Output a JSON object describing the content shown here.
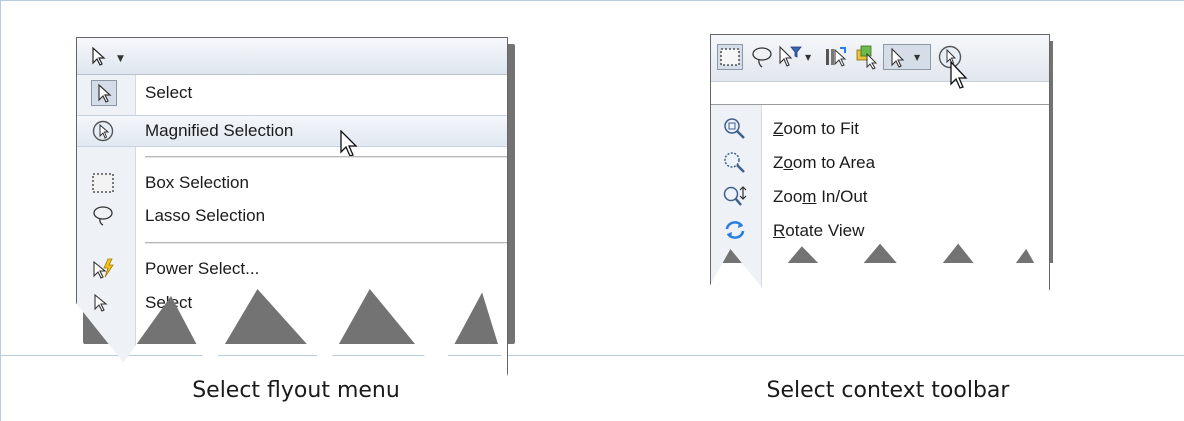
{
  "left": {
    "caption": "Select flyout menu",
    "menu_items": [
      {
        "label": "Select",
        "icon": "select-arrow-icon"
      },
      {
        "label": "Magnified Selection",
        "icon": "magnified-selection-icon"
      },
      {
        "label": "Box Selection",
        "icon": "box-selection-icon"
      },
      {
        "label": "Lasso Selection",
        "icon": "lasso-selection-icon"
      },
      {
        "label": "Power Select...",
        "icon": "power-select-icon"
      },
      {
        "label": "Select",
        "icon": "select-other-icon"
      }
    ]
  },
  "right": {
    "caption": "Select context toolbar",
    "toolbar_icons": [
      "box-selection-icon",
      "lasso-selection-icon",
      "selection-filter-icon",
      "dropdown-arrow-icon",
      "select-other-icon",
      "select-same-icon",
      "select-arrow-icon",
      "dropdown-arrow-icon",
      "magnified-selection-icon"
    ],
    "menu_items": [
      {
        "label_pre": "",
        "mnemonic": "Z",
        "label_post": "oom to Fit",
        "icon": "zoom-to-fit-icon"
      },
      {
        "label_pre": "Z",
        "mnemonic": "o",
        "label_post": "om to Area",
        "icon": "zoom-to-area-icon"
      },
      {
        "label_pre": "Zoo",
        "mnemonic": "m",
        "label_post": " In/Out",
        "icon": "zoom-in-out-icon"
      },
      {
        "label_pre": "",
        "mnemonic": "R",
        "label_post": "otate View",
        "icon": "rotate-view-icon"
      }
    ]
  },
  "colors": {
    "frame_line": "#b6cde0",
    "accent": "#2a7de1"
  }
}
